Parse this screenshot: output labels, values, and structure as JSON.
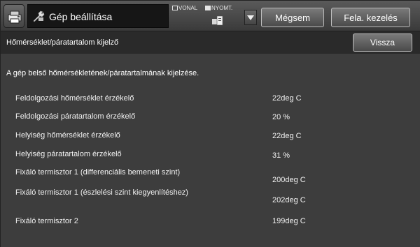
{
  "header": {
    "title": "Gép beállítása",
    "mode_line": "VONAL",
    "mode_print": "NYOMT.",
    "cancel_label": "Mégsem",
    "job_label": "Fela. kezelés"
  },
  "subheader": {
    "title": "Hőmérséklet/páratartalom kijelző",
    "back_label": "Vissza"
  },
  "main": {
    "description": "A gép belső hőmérsékletének/páratartalmának kijelzése.",
    "rows": [
      {
        "label": "Feldolgozási hőmérséklet érzékelő",
        "value": "22deg C"
      },
      {
        "label": "Feldolgozási páratartalom érzékelő",
        "value": "20 %"
      },
      {
        "label": "Helyiség hőmérséklet érzékelő",
        "value": "22deg C"
      },
      {
        "label": "Helyiség páratartalom érzékelő",
        "value": "31 %"
      },
      {
        "label": "Fixáló termisztor 1 (differenciális bemeneti szint)",
        "value": "200deg C"
      },
      {
        "label": "Fixáló termisztor 1 (észlelési szint kiegyenlítéshez)",
        "value": "202deg C"
      },
      {
        "label": "Fixáló termisztor 2",
        "value": "199deg C"
      }
    ]
  },
  "colors": {
    "background": "#3d3d3d",
    "title_box": "#161616",
    "text": "#ffffff"
  },
  "icons": {
    "home": "printer-home-icon",
    "title": "wrench-icon",
    "print": "print-status-icon",
    "dropdown": "triangle-down-icon"
  }
}
